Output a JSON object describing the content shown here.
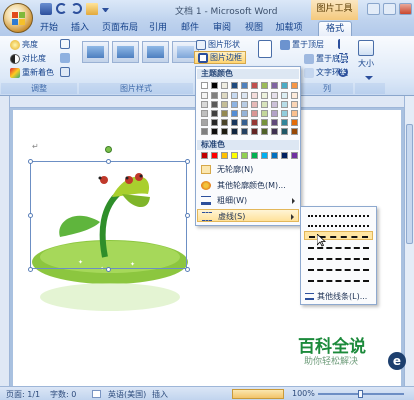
{
  "window": {
    "title": "文档 1 - Microsoft Word",
    "tools_tab": "图片工具"
  },
  "tabs": [
    "开始",
    "插入",
    "页面布局",
    "引用",
    "邮件",
    "审阅",
    "视图",
    "加载项",
    "格式"
  ],
  "ribbon": {
    "adjust": {
      "label": "调整",
      "buttons": [
        "亮度",
        "对比度",
        "重新着色"
      ]
    },
    "picture_styles": {
      "label": "图片样式",
      "buttons": [
        "图片形状",
        "图片边框"
      ]
    },
    "arrange": {
      "label": "列",
      "buttons": [
        "置于顶层",
        "置于底层",
        "文字环绕"
      ]
    },
    "size": {
      "label": "大小"
    }
  },
  "dropdown": {
    "theme_colors_header": "主题颜色",
    "standard_colors_header": "标准色",
    "no_outline": "无轮廓(N)",
    "more_colors": "其他轮廓颜色(M)...",
    "weight": "粗细(W)",
    "dashes": "虚线(S)",
    "theme_colors": [
      [
        "#ffffff",
        "#000000",
        "#eeece1",
        "#1f497d",
        "#4f81bd",
        "#c0504d",
        "#9bbb59",
        "#8064a2",
        "#4bacc6",
        "#f79646"
      ],
      [
        "#f2f2f2",
        "#7f7f7f",
        "#ddd9c3",
        "#c6d9f0",
        "#dbe5f1",
        "#f2dcdb",
        "#ebf1dd",
        "#e5e0ec",
        "#dbeef3",
        "#fdeada"
      ],
      [
        "#d8d8d8",
        "#595959",
        "#c4bd97",
        "#8db3e2",
        "#b8cce4",
        "#e5b9b7",
        "#d7e3bc",
        "#ccc1d9",
        "#b7dde8",
        "#fbd5b5"
      ],
      [
        "#bfbfbf",
        "#3f3f3f",
        "#938953",
        "#548dd4",
        "#95b3d7",
        "#d99694",
        "#c3d69b",
        "#b2a2c7",
        "#92cddc",
        "#fac08f"
      ],
      [
        "#a5a5a5",
        "#262626",
        "#494429",
        "#17365d",
        "#366092",
        "#953734",
        "#76923c",
        "#5f497a",
        "#31859b",
        "#e36c09"
      ],
      [
        "#7f7f7f",
        "#0c0c0c",
        "#1d1b10",
        "#0f243e",
        "#244061",
        "#632423",
        "#4f6128",
        "#3f3151",
        "#205867",
        "#974806"
      ]
    ],
    "standard_colors": [
      "#c00000",
      "#ff0000",
      "#ffc000",
      "#ffff00",
      "#92d050",
      "#00b050",
      "#00b0f0",
      "#0070c0",
      "#002060",
      "#7030a0"
    ]
  },
  "submenu": {
    "more_lines": "其他线条(L)..."
  },
  "statusbar": {
    "page": "页面: 1/1",
    "words": "字数: 0",
    "language": "英语(美国)",
    "insert_mode": "插入",
    "zoom": "100%"
  },
  "watermark": {
    "title": "百科全说",
    "subtitle": "助你轻松解决"
  }
}
